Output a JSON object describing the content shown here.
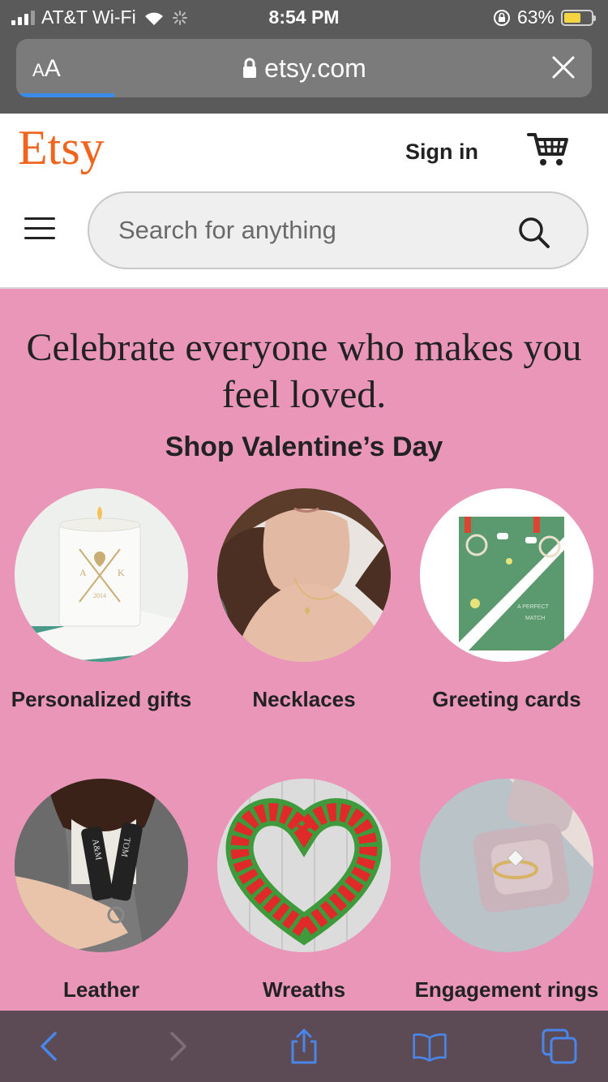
{
  "status": {
    "carrier": "AT&T Wi-Fi",
    "time": "8:54 PM",
    "battery": "63%",
    "battery_level": 0.63
  },
  "browser": {
    "text_size_label": "AA",
    "domain": "etsy.com",
    "load_progress": 0.17
  },
  "header": {
    "logo": "Etsy",
    "sign_in": "Sign in",
    "search_placeholder": "Search for anything"
  },
  "hero": {
    "headline": "Celebrate everyone who makes you feel loved.",
    "subheading": "Shop Valentine’s Day",
    "categories": [
      {
        "label": "Personalized gifts",
        "image": "candle-photo"
      },
      {
        "label": "Necklaces",
        "image": "necklace-photo"
      },
      {
        "label": "Greeting cards",
        "image": "card-photo"
      },
      {
        "label": "Leather accessories",
        "image": "keychain-photo"
      },
      {
        "label": "Wreaths",
        "image": "wreath-photo"
      },
      {
        "label": "Engagement rings",
        "image": "ring-photo"
      }
    ]
  },
  "colors": {
    "brand": "#f1641e",
    "hero_bg": "#e996b8",
    "safari_accent": "#3b8beb"
  },
  "toolbar": {
    "icons": [
      "back-icon",
      "forward-icon",
      "share-icon",
      "bookmarks-icon",
      "tabs-icon"
    ]
  }
}
